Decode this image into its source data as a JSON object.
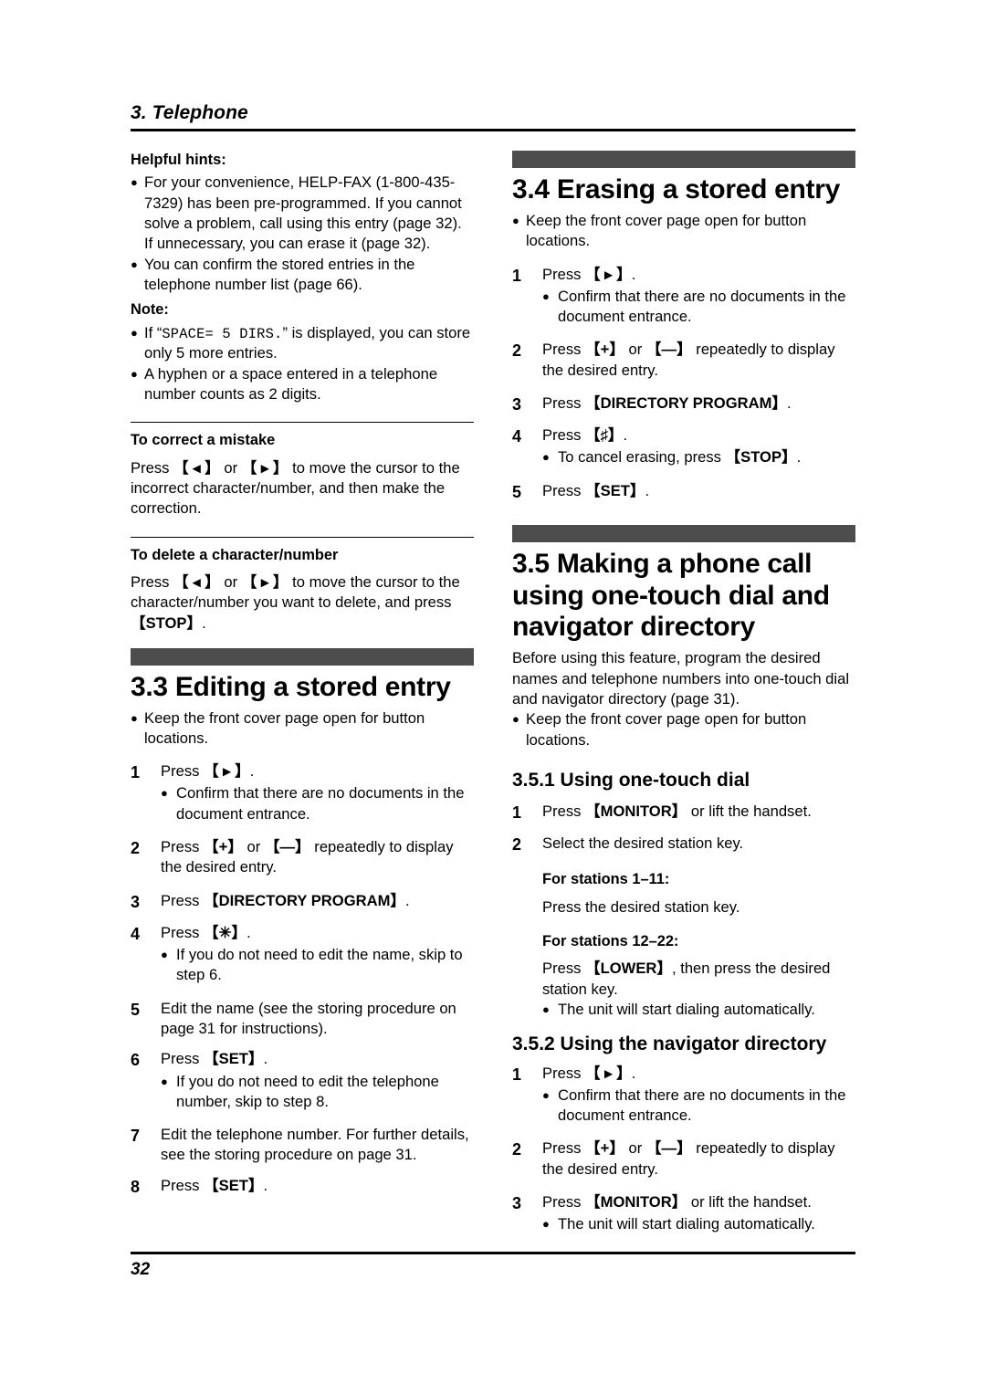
{
  "header": {
    "chapter": "3. Telephone"
  },
  "footer": {
    "page_number": "32"
  },
  "colors": {
    "banner": "#4d4d4d",
    "text": "#000000",
    "background": "#ffffff"
  },
  "left_column": {
    "helpful_hints": {
      "label": "Helpful hints:",
      "bullets": [
        "For your convenience, HELP-FAX (1-800-435-7329) has been pre-programmed. If you cannot solve a problem, call using this entry (page 32). If unnecessary, you can erase it (page 32).",
        "You can confirm the stored entries in the telephone number list (page 66)."
      ]
    },
    "note": {
      "label": "Note:",
      "bullet1_pre": "If “",
      "bullet1_mono": "SPACE= 5 DIRS.",
      "bullet1_post": "” is displayed, you can store only 5 more entries.",
      "bullet2": "A hyphen or a space entered in a telephone number counts as 2 digits."
    },
    "correct_mistake": {
      "heading": "To correct a mistake",
      "text_pre": "Press ",
      "key_left": "【 ◂ 】",
      "text_mid": " or ",
      "key_right": "【 ▸ 】",
      "text_post": " to move the cursor to the incorrect character/number, and then make the correction."
    },
    "delete_character": {
      "heading": "To delete a character/number",
      "text_pre": "Press ",
      "key_left": "【 ◂ 】",
      "text_mid": " or ",
      "key_right": "【 ▸ 】",
      "text_post": " to move the cursor to the character/number you want to delete, and press ",
      "key_stop": "【STOP】",
      "text_end": "."
    },
    "section_3_3": {
      "title": "3.3 Editing a stored entry",
      "lead_bullet": "Keep the front cover page open for button locations.",
      "steps": [
        {
          "num": "1",
          "pre": "Press ",
          "key": "【 ▸ 】",
          "post": ".",
          "sub_bullets": [
            "Confirm that there are no documents in the document entrance."
          ]
        },
        {
          "num": "2",
          "pre": "Press ",
          "key": "【+】",
          "mid": " or ",
          "key2": "【—】",
          "post": " repeatedly to display the desired entry.",
          "sub_bullets": []
        },
        {
          "num": "3",
          "pre": "Press ",
          "key": "【DIRECTORY PROGRAM】",
          "post": ".",
          "sub_bullets": []
        },
        {
          "num": "4",
          "pre": "Press ",
          "key": "【✳】",
          "post": ".",
          "sub_bullets": [
            "If you do not need to edit the name, skip to step 6."
          ]
        },
        {
          "num": "5",
          "pre": "Edit the name (see the storing procedure on page 31 for instructions).",
          "key": "",
          "post": "",
          "sub_bullets": []
        },
        {
          "num": "6",
          "pre": "Press ",
          "key": "【SET】",
          "post": ".",
          "sub_bullets": [
            "If you do not need to edit the telephone number, skip to step 8."
          ]
        },
        {
          "num": "7",
          "pre": "Edit the telephone number. For further details, see the storing procedure on page 31.",
          "key": "",
          "post": "",
          "sub_bullets": []
        },
        {
          "num": "8",
          "pre": "Press ",
          "key": "【SET】",
          "post": ".",
          "sub_bullets": []
        }
      ]
    }
  },
  "right_column": {
    "section_3_4": {
      "title": "3.4 Erasing a stored entry",
      "lead_bullet": "Keep the front cover page open for button locations.",
      "steps": [
        {
          "num": "1",
          "pre": "Press ",
          "key": "【 ▸ 】",
          "post": ".",
          "sub_bullets": [
            "Confirm that there are no documents in the document entrance."
          ]
        },
        {
          "num": "2",
          "pre": "Press ",
          "key": "【+】",
          "mid": " or ",
          "key2": "【—】",
          "post": " repeatedly to display the desired entry.",
          "sub_bullets": []
        },
        {
          "num": "3",
          "pre": "Press ",
          "key": "【DIRECTORY PROGRAM】",
          "post": ".",
          "sub_bullets": []
        },
        {
          "num": "4",
          "pre": "Press ",
          "key": "【♯】",
          "post": ".",
          "sub_bullets": []
        },
        {
          "num": "5",
          "pre": "Press ",
          "key": "【SET】",
          "post": ".",
          "sub_bullets": []
        }
      ],
      "step4_cancel_pre": "To cancel erasing, press ",
      "step4_cancel_key": "【STOP】",
      "step4_cancel_post": "."
    },
    "section_3_5": {
      "title": "3.5 Making a phone call using one-touch dial and navigator directory",
      "intro": "Before using this feature, program the desired names and telephone numbers into one-touch dial and navigator directory (page 31).",
      "lead_bullet": "Keep the front cover page open for button locations.",
      "sub_3_5_1": {
        "title": "3.5.1 Using one-touch dial",
        "step1_pre": "Press ",
        "step1_key": "【MONITOR】",
        "step1_post": " or lift the handset.",
        "step1_num": "1",
        "step2_num": "2",
        "step2_text": "Select the desired station key.",
        "stations_1_11_label": "For stations 1–11:",
        "stations_1_11_text": "Press the desired station key.",
        "stations_12_22_label": "For stations 12–22:",
        "stations_12_22_pre": "Press ",
        "stations_12_22_key": "【LOWER】",
        "stations_12_22_post": ", then press the desired station key.",
        "auto_dial_bullet": "The unit will start dialing automatically."
      },
      "sub_3_5_2": {
        "title": "3.5.2 Using the navigator directory",
        "steps": [
          {
            "num": "1",
            "pre": "Press ",
            "key": "【 ▸ 】",
            "post": ".",
            "sub_bullets": [
              "Confirm that there are no documents in the document entrance."
            ]
          },
          {
            "num": "2",
            "pre": "Press ",
            "key": "【+】",
            "mid": " or ",
            "key2": "【—】",
            "post": " repeatedly to display the desired entry.",
            "sub_bullets": []
          },
          {
            "num": "3",
            "pre": "Press ",
            "key": "【MONITOR】",
            "post": " or lift the handset.",
            "sub_bullets": [
              "The unit will start dialing automatically."
            ]
          }
        ]
      }
    }
  }
}
